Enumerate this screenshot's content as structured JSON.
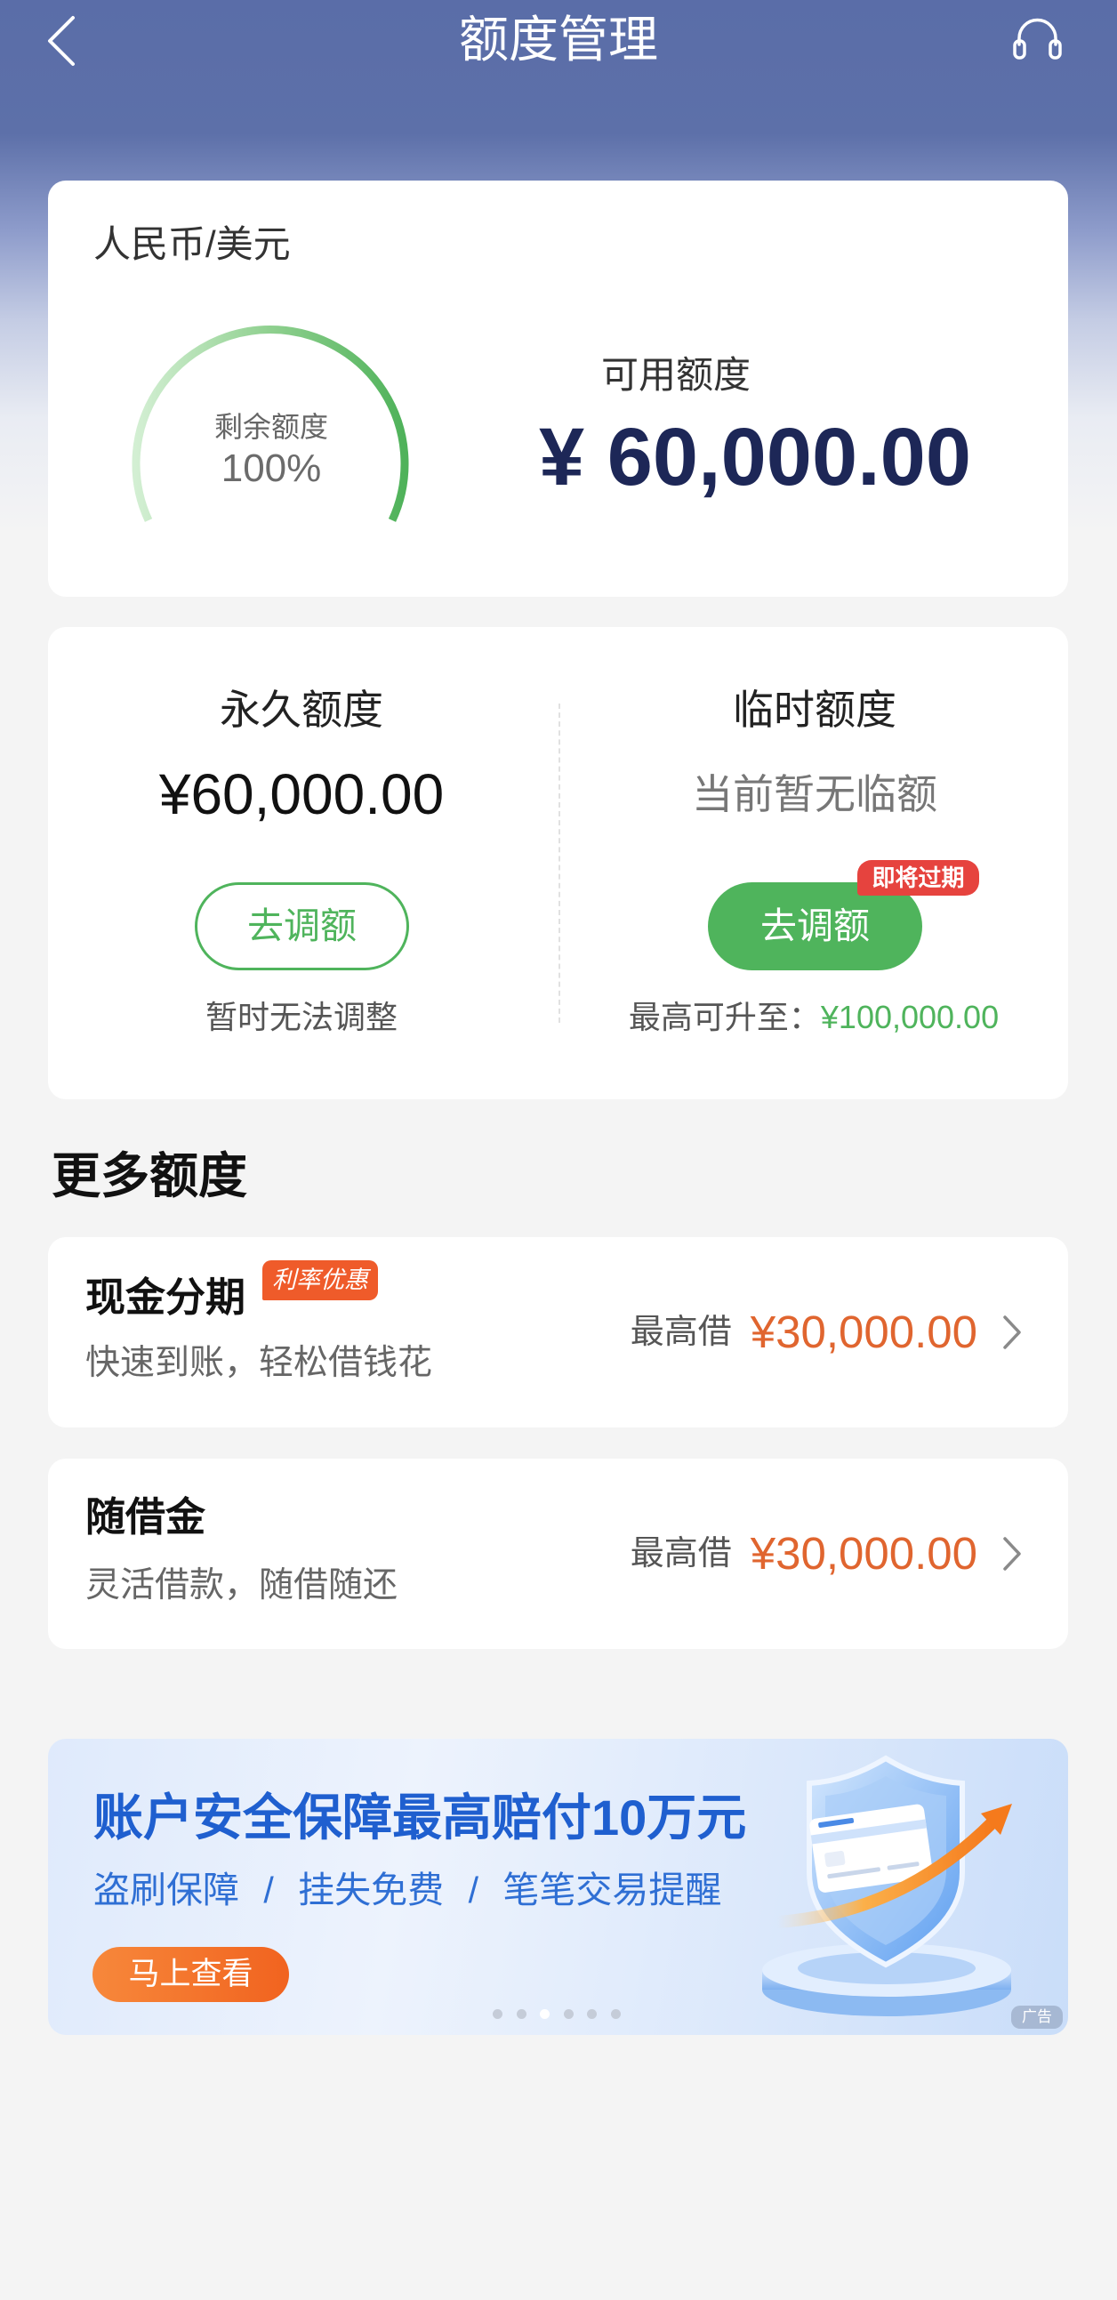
{
  "colors": {
    "brand": "#5a6da8",
    "navy": "#1d2757",
    "green": "#4fb45c",
    "orange": "#e0652f",
    "badge_red": "#e6433e",
    "badge_orange": "#ef5b2a",
    "banner_blue": "#1f5fcf"
  },
  "header": {
    "title": "额度管理",
    "back_icon": "back-chevron-icon",
    "service_icon": "headset-icon"
  },
  "overview": {
    "currency": "人民币/美元",
    "gauge": {
      "label": "剩余额度",
      "percent_text": "100%",
      "fill_fraction": 1.0
    },
    "available_label": "可用额度",
    "available_amount": "¥ 60,000.00"
  },
  "limits": {
    "permanent": {
      "title": "永久额度",
      "amount": "¥60,000.00",
      "button": "去调额",
      "note": "暂时无法调整"
    },
    "temporary": {
      "title": "临时额度",
      "status": "当前暂无临额",
      "button": "去调额",
      "badge": "即将过期",
      "max_label": "最高可升至：",
      "max_amount": "¥100,000.00"
    }
  },
  "more": {
    "heading": "更多额度",
    "items": [
      {
        "title": "现金分期",
        "badge": "利率优惠",
        "subtitle": "快速到账，轻松借钱花",
        "max_label": "最高借",
        "max_amount": "¥30,000.00",
        "arrow_icon": "chevron-right-icon"
      },
      {
        "title": "随借金",
        "subtitle": "灵活借款，随借随还",
        "max_label": "最高借",
        "max_amount": "¥30,000.00",
        "arrow_icon": "chevron-right-icon"
      }
    ]
  },
  "banner": {
    "title": "账户安全保障最高赔付10万元",
    "subtitle": "盗刷保障 / 挂失免费 / 笔笔交易提醒",
    "button": "马上查看",
    "ad_tag": "广告",
    "illustration": "shield-card-icon",
    "carousel": {
      "count": 6,
      "active_index": 2
    }
  }
}
